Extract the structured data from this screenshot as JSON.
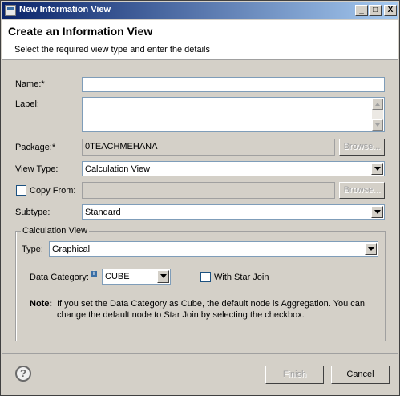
{
  "window": {
    "title": "New Information View",
    "minimize": "_",
    "maximize": "□",
    "close": "X"
  },
  "header": {
    "title": "Create an Information View",
    "subtitle": "Select the required view type and enter the details"
  },
  "form": {
    "name_label": "Name:*",
    "name_value": "",
    "label_label": "Label:",
    "label_value": "",
    "package_label": "Package:*",
    "package_value": "0TEACHMEHANA",
    "browse_label": "Browse...",
    "view_type_label": "View Type:",
    "view_type_value": "Calculation View",
    "copy_from_label": "Copy From:",
    "copy_from_value": "",
    "subtype_label": "Subtype:",
    "subtype_value": "Standard"
  },
  "calc_view": {
    "group_title": "Calculation View",
    "type_label": "Type:",
    "type_value": "Graphical",
    "data_category_label": "Data Category:",
    "data_category_value": "CUBE",
    "star_join_label": "With Star Join",
    "note_bold": "Note:",
    "note_line1": "If you set the Data Category as Cube, the default node is Aggregation. You can",
    "note_line2": "change the default node to Star Join by selecting the checkbox."
  },
  "footer": {
    "help": "?",
    "finish_label": "Finish",
    "cancel_label": "Cancel"
  }
}
